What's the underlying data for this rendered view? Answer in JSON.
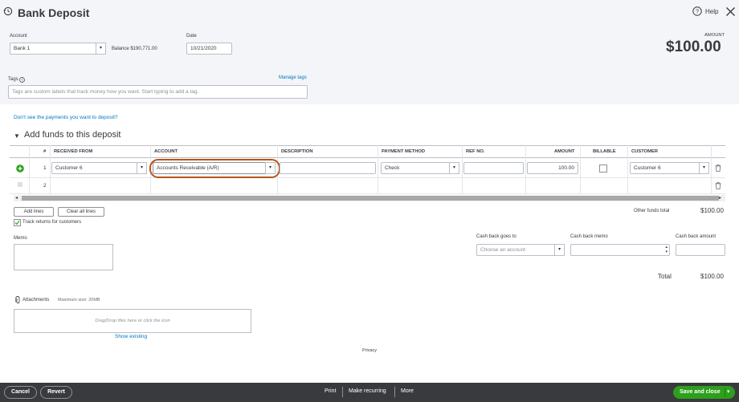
{
  "header": {
    "title": "Bank Deposit",
    "help_label": "Help",
    "amount_label": "AMOUNT",
    "amount_value": "$100.00"
  },
  "account": {
    "label": "Account",
    "value": "Bank 1",
    "balance": "Balance $190,771.00"
  },
  "date": {
    "label": "Date",
    "value": "10/21/2020"
  },
  "tags": {
    "label": "Tags",
    "manage": "Manage tags",
    "placeholder": "Tags are custom labels that track money how you want. Start typing to add a tag."
  },
  "payments_link": "Don't see the payments you want to deposit?",
  "section_title": "Add funds to this deposit",
  "table": {
    "headers": {
      "num": "#",
      "received_from": "RECEIVED FROM",
      "account": "ACCOUNT",
      "description": "DESCRIPTION",
      "payment_method": "PAYMENT METHOD",
      "ref_no": "REF NO.",
      "amount": "AMOUNT",
      "billable": "BILLABLE",
      "customer": "CUSTOMER"
    },
    "rows": [
      {
        "num": "1",
        "received_from": "Customer 6",
        "account": "Accounts Receivable (A/R)",
        "description": "",
        "payment_method": "Check",
        "ref_no": "",
        "amount": "100.00",
        "customer": "Customer 6"
      },
      {
        "num": "2"
      }
    ]
  },
  "buttons": {
    "add_lines": "Add lines",
    "clear_lines": "Clear all lines"
  },
  "other_funds": {
    "label": "Other funds total",
    "value": "$100.00"
  },
  "track_returns": "Track returns for customers",
  "memo_label": "Memo",
  "cash_back": {
    "goes_to_label": "Cash back goes to",
    "goes_to_placeholder": "Choose an account",
    "memo_label": "Cash back memo",
    "amount_label": "Cash back amount"
  },
  "total": {
    "label": "Total",
    "value": "$100.00"
  },
  "attachments": {
    "label": "Attachments",
    "max_size": "Maximum size: 20MB",
    "drop_text": "Drag/Drop files here or click the icon",
    "show_existing": "Show existing"
  },
  "privacy": "Privacy",
  "footer": {
    "cancel": "Cancel",
    "revert": "Revert",
    "print": "Print",
    "make_recurring": "Make recurring",
    "more": "More",
    "save_close": "Save and close"
  },
  "colors": {
    "accent_green": "#2ca01c",
    "link_blue": "#0077c5",
    "footer_bg": "#393a3d",
    "highlight_ring": "#b5561c"
  }
}
